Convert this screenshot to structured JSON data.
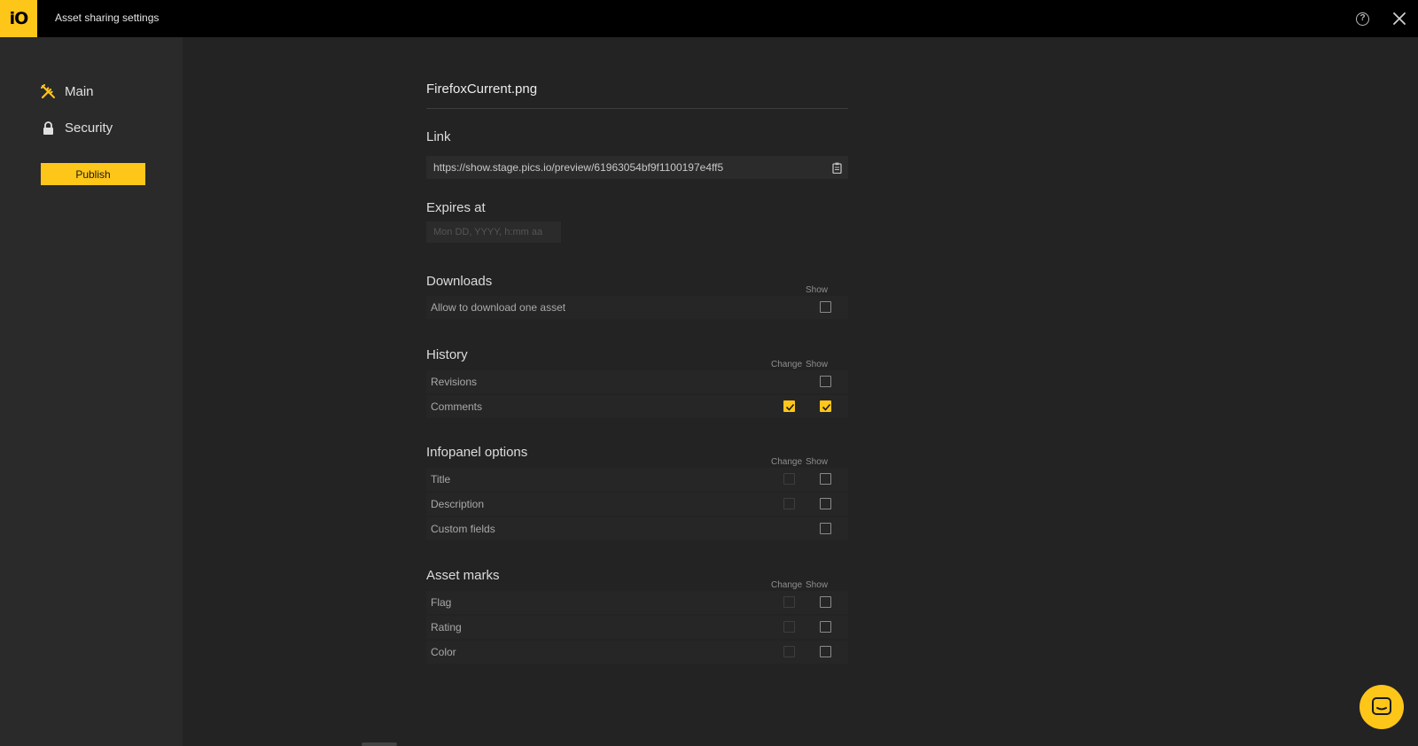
{
  "topbar": {
    "logo_text": "iO",
    "title": "Asset sharing settings",
    "help_icon": "help-circle-icon",
    "close_icon": "close-icon"
  },
  "sidebar": {
    "items": [
      {
        "label": "Main",
        "icon": "tools-icon",
        "active": true
      },
      {
        "label": "Security",
        "icon": "lock-icon",
        "active": false
      }
    ],
    "publish_label": "Publish"
  },
  "main": {
    "filename": "FirefoxCurrent.png",
    "link": {
      "title": "Link",
      "url": "https://show.stage.pics.io/preview/61963054bf9f1100197e4ff5",
      "copy_icon": "clipboard-icon"
    },
    "expires": {
      "title": "Expires at",
      "placeholder": "Mon DD, YYYY, h:mm aa",
      "value": ""
    },
    "downloads": {
      "title": "Downloads",
      "show_label": "Show",
      "rows": [
        {
          "label": "Allow to download one asset",
          "show": false
        }
      ]
    },
    "history": {
      "title": "History",
      "change_label": "Change",
      "show_label": "Show",
      "rows": [
        {
          "label": "Revisions",
          "change": null,
          "show": false
        },
        {
          "label": "Comments",
          "change": true,
          "show": true
        }
      ]
    },
    "infopanel": {
      "title": "Infopanel options",
      "change_label": "Change",
      "show_label": "Show",
      "rows": [
        {
          "label": "Title",
          "change": false,
          "show": false
        },
        {
          "label": "Description",
          "change": false,
          "show": false
        },
        {
          "label": "Custom fields",
          "change": null,
          "show": false
        }
      ]
    },
    "asset_marks": {
      "title": "Asset marks",
      "change_label": "Change",
      "show_label": "Show",
      "rows": [
        {
          "label": "Flag",
          "change": false,
          "show": false
        },
        {
          "label": "Rating",
          "change": false,
          "show": false
        },
        {
          "label": "Color",
          "change": false,
          "show": false
        }
      ]
    }
  },
  "colors": {
    "accent": "#ffc61a",
    "background": "#232323",
    "sidebar": "#2a2a2a",
    "topbar": "#000000"
  },
  "chat_icon": "chat-bubble-icon"
}
